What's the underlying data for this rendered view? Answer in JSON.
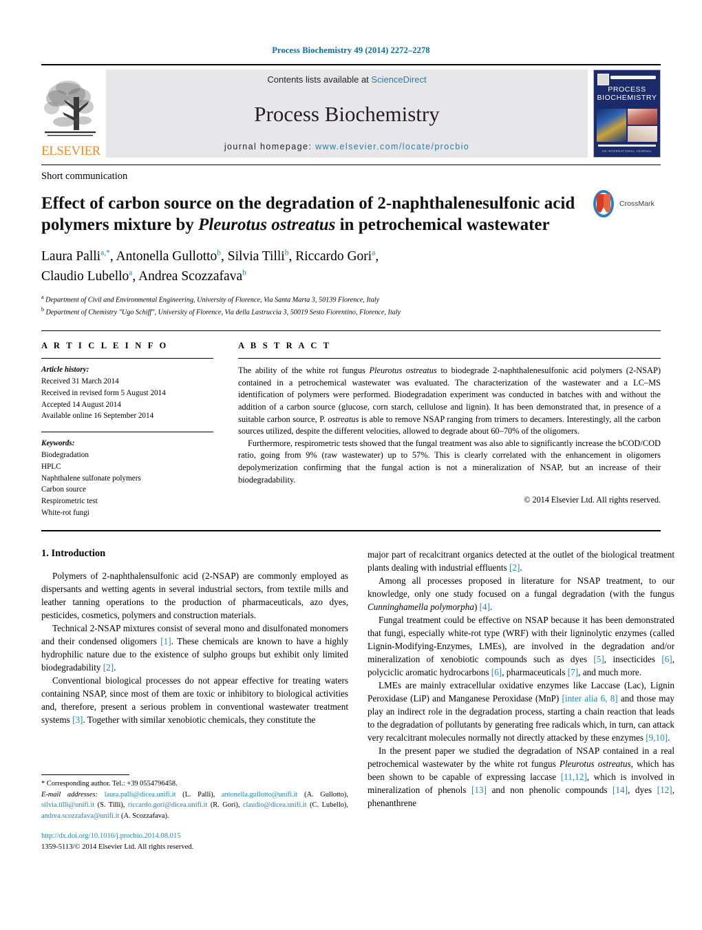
{
  "journal_ref": "Process Biochemistry 49 (2014) 2272–2278",
  "masthead": {
    "publisher": "ELSEVIER",
    "contents_prefix": "Contents lists available at ",
    "sciencedirect": "ScienceDirect",
    "journal_title": "Process Biochemistry",
    "homepage_label": "journal homepage: ",
    "homepage_url": "www.elsevier.com/locate/procbio",
    "cover": {
      "title_line1": "PROCESS",
      "title_line2": "BIOCHEMISTRY",
      "footer": "AN INTERNATIONAL JOURNAL"
    }
  },
  "article": {
    "type": "Short communication",
    "title_part1": "Effect of carbon source on the degradation of 2-naphthalenesulfonic acid polymers mixture by ",
    "title_italic": "Pleurotus ostreatus",
    "title_part2": " in petrochemical wastewater",
    "crossmark_label": "CrossMark",
    "authors": "Laura Palli a,*, Antonella Gullotto b, Silvia Tilli b, Riccardo Gori a, Claudio Lubello a, Andrea Scozzafava b",
    "affiliation_a": "Department of Civil and Environmental Engineering, University of Florence, Via Santa Marta 3, 50139 Florence, Italy",
    "affiliation_b": "Department of Chemistry \"Ugo Schiff\", University of Florence, Via della Lastruccia 3, 50019 Sesto Fiorentino, Florence, Italy"
  },
  "article_info": {
    "heading": "A R T I C L E   I N F O",
    "history_label": "Article history:",
    "history": [
      "Received 31 March 2014",
      "Received in revised form 5 August 2014",
      "Accepted 14 August 2014",
      "Available online 16 September 2014"
    ],
    "keywords_label": "Keywords:",
    "keywords": [
      "Biodegradation",
      "HPLC",
      "Naphthalene sulfonate polymers",
      "Carbon source",
      "Respirometric test",
      "White-rot fungi"
    ]
  },
  "abstract": {
    "heading": "A B S T R A C T",
    "para1_a": "The ability of the white rot fungus ",
    "para1_italic1": "Pleurotus ostreatus",
    "para1_b": " to biodegrade 2-naphthalenesulfonic acid polymers (2-NSAP) contained in a petrochemical wastewater was evaluated. The characterization of the wastewater and a LC–MS identification of polymers were performed. Biodegradation experiment was conducted in batches with and without the addition of a carbon source (glucose, corn starch, cellulose and lignin). It has been demonstrated that, in presence of a suitable carbon source, P. ",
    "para1_italic2": "ostreatus",
    "para1_c": " is able to remove NSAP ranging from trimers to decamers. Interestingly, all the carbon sources utilized, despite the different velocities, allowed to degrade about 60–70% of the oligomers.",
    "para2": "Furthermore, respirometric tests showed that the fungal treatment was also able to significantly increase the bCOD/COD ratio, going from 9% (raw wastewater) up to 57%. This is clearly correlated with the enhancement in oligomers depolymerization confirming that the fungal action is not a mineralization of NSAP, but an increase of their biodegradability.",
    "copyright": "© 2014 Elsevier Ltd. All rights reserved."
  },
  "introduction": {
    "heading": "1.  Introduction",
    "left": {
      "p1": "Polymers of 2-naphthalensulfonic acid (2-NSAP) are commonly employed as dispersants and wetting agents in several industrial sectors, from textile mills and leather tanning operations to the production of pharmaceuticals, azo dyes, pesticides, cosmetics, polymers and construction materials.",
      "p2_a": "Technical 2-NSAP mixtures consist of several mono and disulfonated monomers and their condensed oligomers ",
      "p2_ref1": "[1]",
      "p2_b": ". These chemicals are known to have a highly hydrophilic nature due to the existence of sulpho groups but exhibit only limited biodegradability ",
      "p2_ref2": "[2]",
      "p2_c": ".",
      "p3_a": "Conventional biological processes do not appear effective for treating waters containing NSAP, since most of them are toxic or inhibitory to biological activities and, therefore, present a serious problem in conventional wastewater treatment systems ",
      "p3_ref1": "[3]",
      "p3_b": ". Together with similar xenobiotic chemicals, they constitute the"
    },
    "right": {
      "p3_cont_a": "major part of recalcitrant organics detected at the outlet of the biological treatment plants dealing with industrial effluents ",
      "p3_cont_ref": "[2]",
      "p3_cont_b": ".",
      "p4_a": "Among all processes proposed in literature for NSAP treatment, to our knowledge, only one study focused on a fungal degradation (with the fungus ",
      "p4_italic": "Cunninghamella polymorpha",
      "p4_b": ") ",
      "p4_ref": "[4]",
      "p4_c": ".",
      "p5_a": "Fungal treatment could be effective on NSAP because it has been demonstrated that fungi, especially white-rot type (WRF) with their ligninolytic enzymes (called Lignin-Modifying-Enzymes, LMEs), are involved in the degradation and/or mineralization of xenobiotic compounds such as dyes ",
      "p5_ref1": "[5]",
      "p5_b": ", insecticides ",
      "p5_ref2": "[6]",
      "p5_c": ", polyciclic aromatic hydrocarbons ",
      "p5_ref3": "[6]",
      "p5_d": ", pharmaceuticals ",
      "p5_ref4": "[7]",
      "p5_e": ", and much more.",
      "p6_a": "LMEs are mainly extracellular oxidative enzymes like Laccase (Lac), Lignin Peroxidase (LiP) and Manganese Peroxidase (MnP) ",
      "p6_ref1": "[inter alia 6, 8]",
      "p6_b": " and those may play an indirect role in the degradation process, starting a chain reaction that leads to the degradation of pollutants by generating free radicals which, in turn, can attack very recalcitrant molecules normally not directly attacked by these enzymes ",
      "p6_ref2": "[9,10]",
      "p6_c": ".",
      "p7_a": "In the present paper we studied the degradation of NSAP contained in a real petrochemical wastewater by the white rot fungus ",
      "p7_italic": "Pleurotus ostreatus",
      "p7_b": ", which has been shown to be capable of expressing laccase ",
      "p7_ref1": "[11,12]",
      "p7_c": ", which is involved in mineralization of phenols ",
      "p7_ref2": "[13]",
      "p7_d": " and non phenolic compounds ",
      "p7_ref3": "[14]",
      "p7_e": ", dyes ",
      "p7_ref4": "[12]",
      "p7_f": ", phenanthrene"
    }
  },
  "footnotes": {
    "corresponding": "* Corresponding author. Tel.: +39 0554796458.",
    "email_label": "E-mail addresses:",
    "emails": [
      {
        "address": "laura.palli@dicea.unifi.it",
        "person": "(L. Palli)"
      },
      {
        "address": "antonella.gullotto@unifi.it",
        "person": "(A. Gullotto)"
      },
      {
        "address": "silvia.tilli@unifi.it",
        "person": "(S. Tilli)"
      },
      {
        "address": "riccardo.gori@dicea.unifi.it",
        "person": "(R. Gori)"
      },
      {
        "address": "claudio@dicea.unifi.it",
        "person": "(C. Lubello)"
      },
      {
        "address": "andrea.scozzafava@unifi.it",
        "person": "(A. Scozzafava)"
      }
    ],
    "doi": "http://dx.doi.org/10.1016/j.procbio.2014.08.015",
    "issn_line": "1359-5113/© 2014 Elsevier Ltd. All rights reserved."
  },
  "colors": {
    "link_blue": "#1c88b8",
    "sd_blue": "#2a7ab0",
    "elsevier_orange": "#f08c21",
    "cover_navy": "#1b2a6b"
  }
}
